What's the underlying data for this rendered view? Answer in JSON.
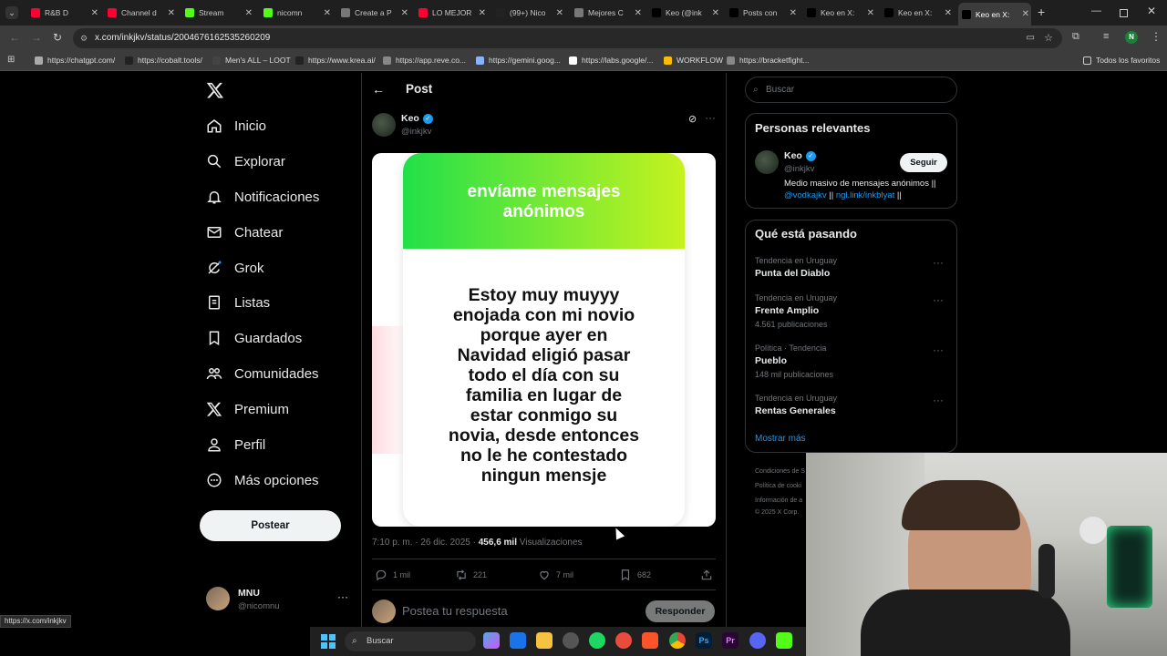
{
  "browser": {
    "tabs": [
      {
        "title": "R&B D",
        "color": "#ff0033"
      },
      {
        "title": "Channel d",
        "color": "#ff0033"
      },
      {
        "title": "Stream",
        "color": "#53fc18"
      },
      {
        "title": "nicomn",
        "color": "#53fc18"
      },
      {
        "title": "Create a P",
        "color": "#777777"
      },
      {
        "title": "LO MEJOR",
        "color": "#ff0033"
      },
      {
        "title": "(99+) Nico",
        "color": "#222222"
      },
      {
        "title": "Mejores C",
        "color": "#777777"
      },
      {
        "title": "Keo (@ink",
        "color": "#000000"
      },
      {
        "title": "Posts con",
        "color": "#000000"
      },
      {
        "title": "Keo en X:",
        "color": "#000000"
      },
      {
        "title": "Keo en X:",
        "color": "#000000"
      },
      {
        "title": "Keo en X:",
        "color": "#000000"
      }
    ],
    "url": "x.com/inkjkv/status/2004676162535260209",
    "bookmarks": [
      {
        "label": "https://chatgpt.com/",
        "color": "#aaaaaa"
      },
      {
        "label": "https://cobalt.tools/",
        "color": "#222222"
      },
      {
        "label": "Men's ALL – LOOT",
        "color": "#444444"
      },
      {
        "label": "https://www.krea.ai/",
        "color": "#222222"
      },
      {
        "label": "https://app.reve.co...",
        "color": "#888888"
      },
      {
        "label": "https://gemini.goog...",
        "color": "#8ab4f8"
      },
      {
        "label": "https://labs.google/...",
        "color": "#ffffff"
      },
      {
        "label": "WORKFLOW",
        "color": "#fbbc04"
      },
      {
        "label": "https://bracketfight...",
        "color": "#888888"
      }
    ],
    "all_bookmarks": "Todos los favoritos",
    "profile_initial": "N",
    "status_url": "https://x.com/inkjkv"
  },
  "nav": {
    "items": [
      "Inicio",
      "Explorar",
      "Notificaciones",
      "Chatear",
      "Grok",
      "Listas",
      "Guardados",
      "Comunidades",
      "Premium",
      "Perfil",
      "Más opciones"
    ],
    "post_button": "Postear",
    "account": {
      "name": "MNU",
      "handle": "@nicomnu"
    }
  },
  "post": {
    "header": "Post",
    "author": {
      "name": "Keo",
      "handle": "@inkjkv"
    },
    "image": {
      "banner_text_line1": "envíame mensajes",
      "banner_text_line2": "anónimos",
      "message_lines": [
        "Estoy muy muyyy",
        "enojada con mi novio",
        "porque ayer en",
        "Navidad eligió pasar",
        "todo el día con su",
        "familia en lugar de",
        "estar conmigo su",
        "novia, desde entonces",
        "no le he contestado",
        "ningun mensje"
      ]
    },
    "time": "7:10 p. m. · 26 dic. 2025 ·",
    "views": "456,6 mil",
    "views_label": "Visualizaciones",
    "replies": "1 mil",
    "reposts": "221",
    "likes": "7 mil",
    "bookmarks": "682",
    "reply_placeholder": "Postea tu respuesta",
    "reply_button": "Responder"
  },
  "sidebar": {
    "search_placeholder": "Buscar",
    "relevant": {
      "title": "Personas relevantes",
      "name": "Keo",
      "handle": "@inkjkv",
      "follow": "Seguir",
      "bio_prefix": "Medio masivo de mensajes anónimos",
      "bio_sep1": "||",
      "bio_link1": "@vodkajkv",
      "bio_sep2": "||",
      "bio_link2": "ngl.link/inkblyat",
      "bio_sep3": "||"
    },
    "trending": {
      "title": "Qué está pasando",
      "items": [
        {
          "category": "Tendencia en Uruguay",
          "name": "Punta del Diablo",
          "count": ""
        },
        {
          "category": "Tendencia en Uruguay",
          "name": "Frente Amplio",
          "count": "4.561 publicaciones"
        },
        {
          "category": "Política · Tendencia",
          "name": "Pueblo",
          "count": "148 mil publicaciones"
        },
        {
          "category": "Tendencia en Uruguay",
          "name": "Rentas Generales",
          "count": ""
        }
      ],
      "show_more": "Mostrar más"
    },
    "footer": [
      "Condiciones de S",
      "Política de cooki",
      "Información de a",
      "© 2025 X Corp."
    ]
  },
  "taskbar": {
    "search": "Buscar"
  }
}
